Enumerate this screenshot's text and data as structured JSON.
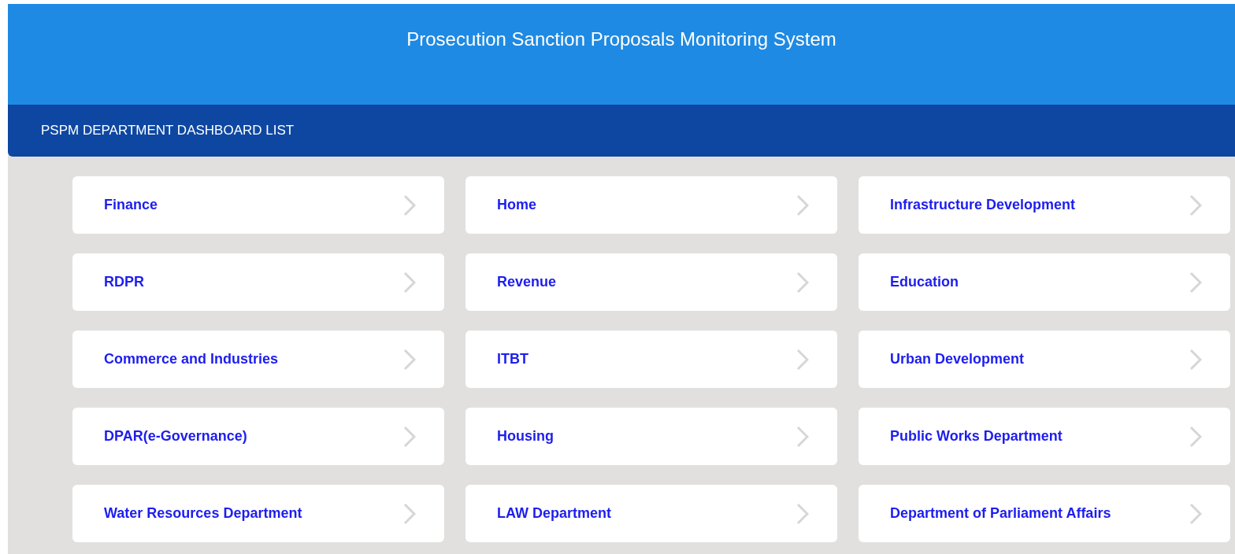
{
  "header": {
    "title": "Prosecution Sanction Proposals Monitoring System"
  },
  "section": {
    "title": "PSPM DEPARTMENT DASHBOARD LIST"
  },
  "departments": [
    {
      "name": "Finance"
    },
    {
      "name": "Home"
    },
    {
      "name": "Infrastructure Development"
    },
    {
      "name": "RDPR"
    },
    {
      "name": "Revenue"
    },
    {
      "name": "Education"
    },
    {
      "name": "Commerce and Industries"
    },
    {
      "name": "ITBT"
    },
    {
      "name": "Urban Development"
    },
    {
      "name": "DPAR(e-Governance)"
    },
    {
      "name": "Housing"
    },
    {
      "name": "Public Works Department"
    },
    {
      "name": "Water Resources Department"
    },
    {
      "name": "LAW Department"
    },
    {
      "name": "Department of Parliament Affairs"
    }
  ]
}
